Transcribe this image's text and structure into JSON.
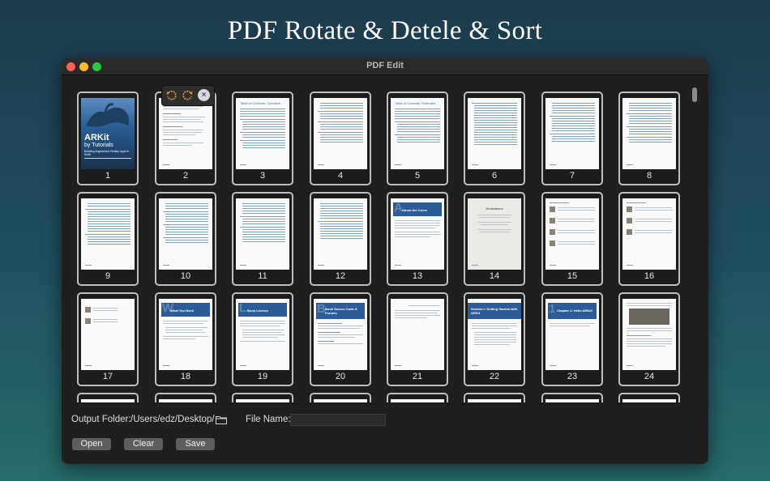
{
  "headline": "PDF Rotate & Detele & Sort",
  "window": {
    "title": "PDF Edit"
  },
  "cover": {
    "title_line1": "ARKit",
    "title_line2": "by Tutorials",
    "subtitle": "Building Augmented Reality Apps in Swift"
  },
  "pages": [
    {
      "num": "1"
    },
    {
      "num": "2"
    },
    {
      "num": "3"
    },
    {
      "num": "4"
    },
    {
      "num": "5"
    },
    {
      "num": "6"
    },
    {
      "num": "7"
    },
    {
      "num": "8"
    },
    {
      "num": "9"
    },
    {
      "num": "10"
    },
    {
      "num": "11"
    },
    {
      "num": "12"
    },
    {
      "num": "13"
    },
    {
      "num": "14"
    },
    {
      "num": "15"
    },
    {
      "num": "16"
    },
    {
      "num": "17"
    },
    {
      "num": "18"
    },
    {
      "num": "19"
    },
    {
      "num": "20"
    },
    {
      "num": "21"
    },
    {
      "num": "22"
    },
    {
      "num": "23"
    },
    {
      "num": "24"
    }
  ],
  "page_texts": {
    "p3": "Table of Contents: Overview",
    "p5": "Table of Contents: Extended",
    "p13": "About the Cover",
    "p14": "Dedications",
    "p18": "What You Need",
    "p19": "Book License",
    "p20": "Book Source Code & Forums",
    "p22": "Section I: Getting Started with ARKit",
    "p23": "Chapter 1: Hello ARKit!"
  },
  "page_toolbar": {
    "rotate_left_icon": "rotate-ccw-icon",
    "rotate_right_icon": "rotate-cw-icon",
    "delete_icon": "close-icon",
    "delete_glyph": "×"
  },
  "footer": {
    "output_folder_label": "Output Folder:",
    "output_folder_path": "/Users/edz/Desktop/",
    "file_name_label": "File Name:",
    "file_name_value": "",
    "open_label": "Open",
    "clear_label": "Clear",
    "save_label": "Save"
  },
  "colors": {
    "accent_rotate": "#e2a032",
    "banner_blue": "#2b5c97"
  }
}
